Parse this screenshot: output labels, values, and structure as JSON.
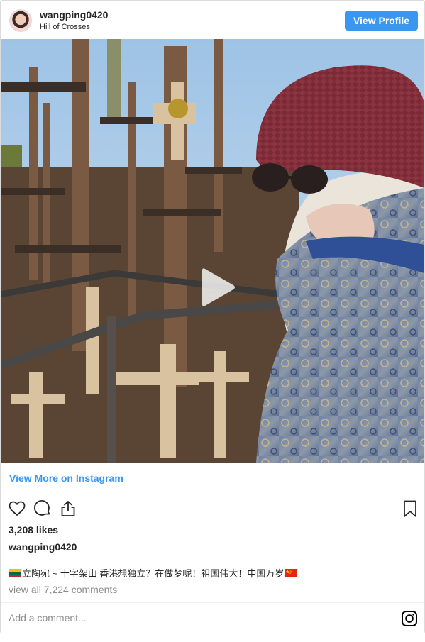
{
  "header": {
    "username": "wangping0420",
    "location": "Hill of Crosses",
    "view_profile_label": "View Profile"
  },
  "media": {
    "kind": "video",
    "play_icon": "play-icon"
  },
  "more_link": "View More on Instagram",
  "actions": {
    "like_icon": "heart-icon",
    "comment_icon": "comment-icon",
    "share_icon": "share-icon",
    "save_icon": "bookmark-icon"
  },
  "likes": "3,208 likes",
  "poster": "wangping0420",
  "caption": {
    "leading_flag": "lithuania-flag",
    "text": "立陶宛 ~ 十字架山 香港想独立？在做梦呢！祖国伟大！中国万岁",
    "trailing_flag": "china-flag"
  },
  "comments_link": "view all 7,224 comments",
  "comment_placeholder": "Add a comment...",
  "colors": {
    "accent": "#3897f0",
    "text": "#262626",
    "muted": "#8e8e8e",
    "border": "#dbdbdb"
  }
}
